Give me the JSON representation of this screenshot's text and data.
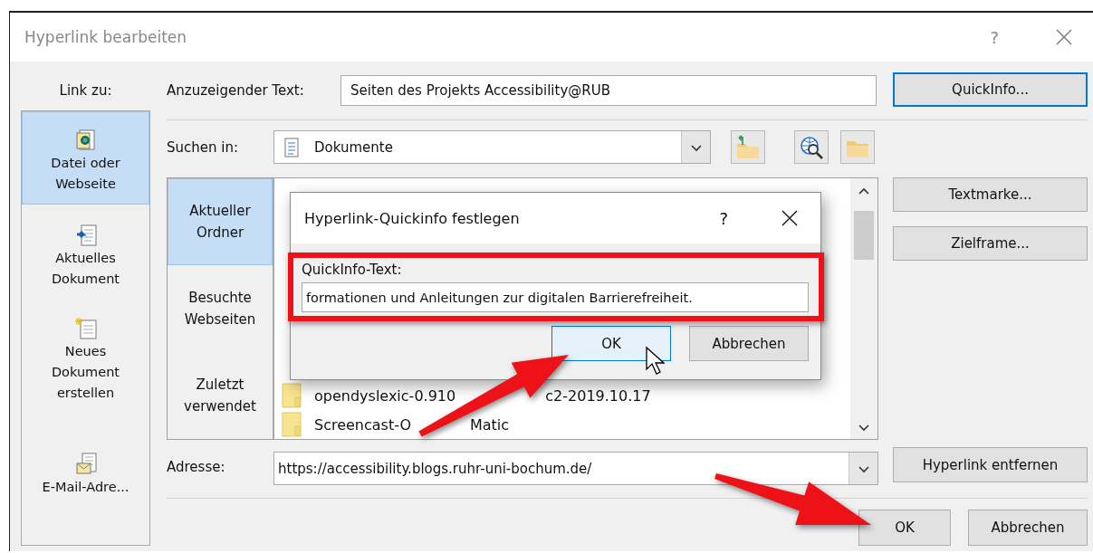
{
  "window": {
    "title": "Hyperlink bearbeiten",
    "help": "?"
  },
  "link_to": {
    "label": "Link zu:",
    "items": [
      {
        "label": "Datei oder Webseite",
        "kind": "file",
        "selected": true
      },
      {
        "label": "Aktuelles Dokument",
        "kind": "current",
        "selected": false
      },
      {
        "label": "Neues Dokument erstellen",
        "kind": "new",
        "selected": false
      },
      {
        "label": "E-Mail-Adre...",
        "kind": "mail",
        "selected": false
      }
    ]
  },
  "display_text": {
    "label": "Anzuzeigender Text:",
    "value": "Seiten des Projekts Accessibility@RUB"
  },
  "look_in": {
    "label": "Suchen in:",
    "value": "Dokumente"
  },
  "places": [
    {
      "label": "Aktueller Ordner",
      "selected": true
    },
    {
      "label": "Besuchte Webseiten",
      "selected": false
    },
    {
      "label": "Zuletzt verwendet",
      "selected": false
    }
  ],
  "files": [
    {
      "parts": [
        "opendyslexic-0.910",
        "c2-2019.10.17"
      ]
    },
    {
      "parts": [
        "Screencast-O",
        "Matic"
      ]
    }
  ],
  "side_buttons": [
    {
      "label": "QuickInfo...",
      "focused": true
    },
    {
      "label": "Textmarke...",
      "focused": false
    },
    {
      "label": "Zielframe...",
      "focused": false
    },
    {
      "label": "Hyperlink entfernen",
      "focused": false
    }
  ],
  "address": {
    "label": "Adresse:",
    "value": "https://accessibility.blogs.ruhr-uni-bochum.de/"
  },
  "footer_buttons": [
    "OK",
    "Abbrechen"
  ],
  "quickinfo_dialog": {
    "title": "Hyperlink-Quickinfo festlegen",
    "help": "?",
    "label": "QuickInfo-Text:",
    "value": "formationen und Anleitungen zur digitalen Barrierefreiheit.",
    "buttons": [
      {
        "label": "OK",
        "highlighted": true
      },
      {
        "label": "Abbrechen",
        "highlighted": false
      }
    ]
  }
}
